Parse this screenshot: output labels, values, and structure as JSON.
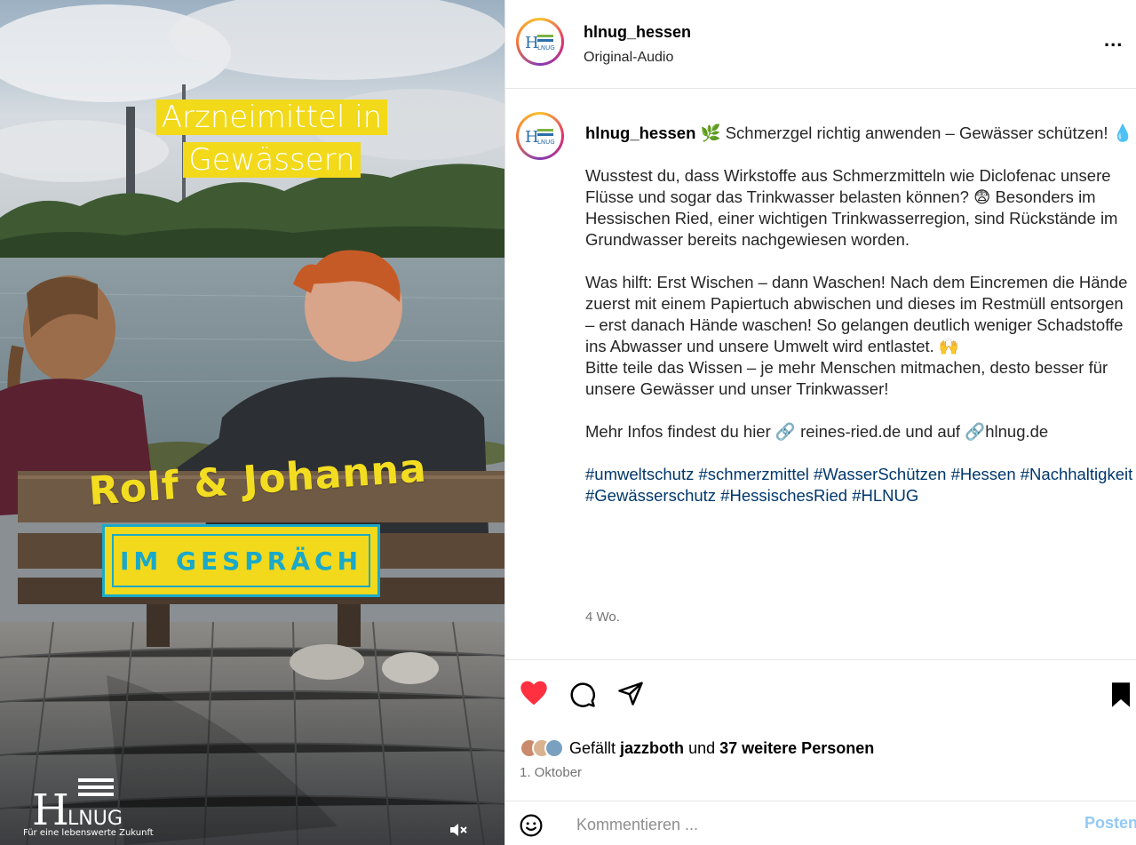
{
  "video": {
    "title_line1": "Arzneimittel in",
    "title_line2": "Gewässern",
    "names": "Rolf  & Johanna",
    "badge": "IM GESPRÄCH",
    "logo_text": "Für eine lebenswerte Zukunft",
    "mute_icon": "speaker-muted-icon"
  },
  "header": {
    "username": "hlnug_hessen",
    "subtitle": "Original-Audio",
    "more": "..."
  },
  "caption": {
    "username": "hlnug_hessen",
    "headline": "🌿 Schmerzgel richtig anwenden – Gewässer schützen! 💧",
    "para1": "Wusstest du, dass Wirkstoffe aus Schmerzmitteln wie Diclofenac unsere Flüsse und sogar das Trinkwasser belasten können? 😨 Besonders im Hessischen Ried, einer wichtigen Trinkwasserregion, sind Rückstände im Grundwasser bereits nachgewiesen worden.",
    "para2": "Was hilft: Erst Wischen – dann Waschen! Nach dem Eincremen die Hände zuerst mit einem Papiertuch abwischen und dieses im Restmüll entsorgen – erst danach Hände waschen! So gelangen deutlich weniger Schadstoffe ins Abwasser und unsere Umwelt wird entlastet. 🙌",
    "para3": "Bitte teile das Wissen – je mehr Menschen mitmachen, desto besser für unsere Gewässer und unser Trinkwasser!",
    "para4": "Mehr Infos findest du hier 🔗 reines-ried.de und auf 🔗hlnug.de",
    "hashtags": "#umweltschutz #schmerzmittel #WasserSchützen #Hessen #Nachhaltigkeit #Gewässerschutz #HessischesRied #HLNUG",
    "age": "4 Wo."
  },
  "actions": {
    "likes_prefix": "Gefällt",
    "likes_user": "jazzboth",
    "likes_and": "und",
    "likes_count": "37 weitere Personen",
    "date": "1. Oktober"
  },
  "comment": {
    "placeholder": "Kommentieren ...",
    "post_label": "Posten"
  },
  "colors": {
    "heart": "#ff3040",
    "link": "#00376b",
    "post_button": "#93c9f5",
    "overlay_yellow": "#f3d91b",
    "overlay_teal": "#1aa9c8"
  }
}
